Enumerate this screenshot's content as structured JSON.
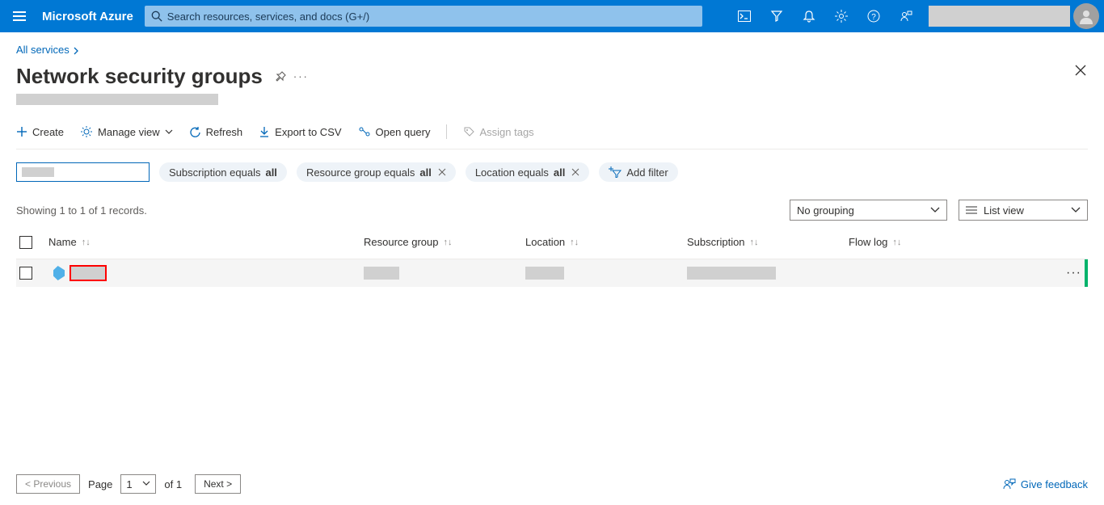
{
  "header": {
    "brand": "Microsoft Azure",
    "search_placeholder": "Search resources, services, and docs (G+/)"
  },
  "breadcrumb": {
    "root": "All services"
  },
  "page": {
    "title": "Network security groups"
  },
  "toolbar": {
    "create": "Create",
    "manage_view": "Manage view",
    "refresh": "Refresh",
    "export_csv": "Export to CSV",
    "open_query": "Open query",
    "assign_tags": "Assign tags"
  },
  "filters": {
    "sub_prefix": "Subscription equals ",
    "sub_val": "all",
    "rg_prefix": "Resource group equals ",
    "rg_val": "all",
    "loc_prefix": "Location equals ",
    "loc_val": "all",
    "add": "Add filter"
  },
  "records_text": "Showing 1 to 1 of 1 records.",
  "view": {
    "grouping": "No grouping",
    "mode": "List view"
  },
  "columns": {
    "name": "Name",
    "rg": "Resource group",
    "loc": "Location",
    "sub": "Subscription",
    "flow": "Flow log"
  },
  "footer": {
    "prev": "< Previous",
    "page_label": "Page",
    "page_num": "1",
    "of_label": "of 1",
    "next": "Next >",
    "feedback": "Give feedback"
  }
}
